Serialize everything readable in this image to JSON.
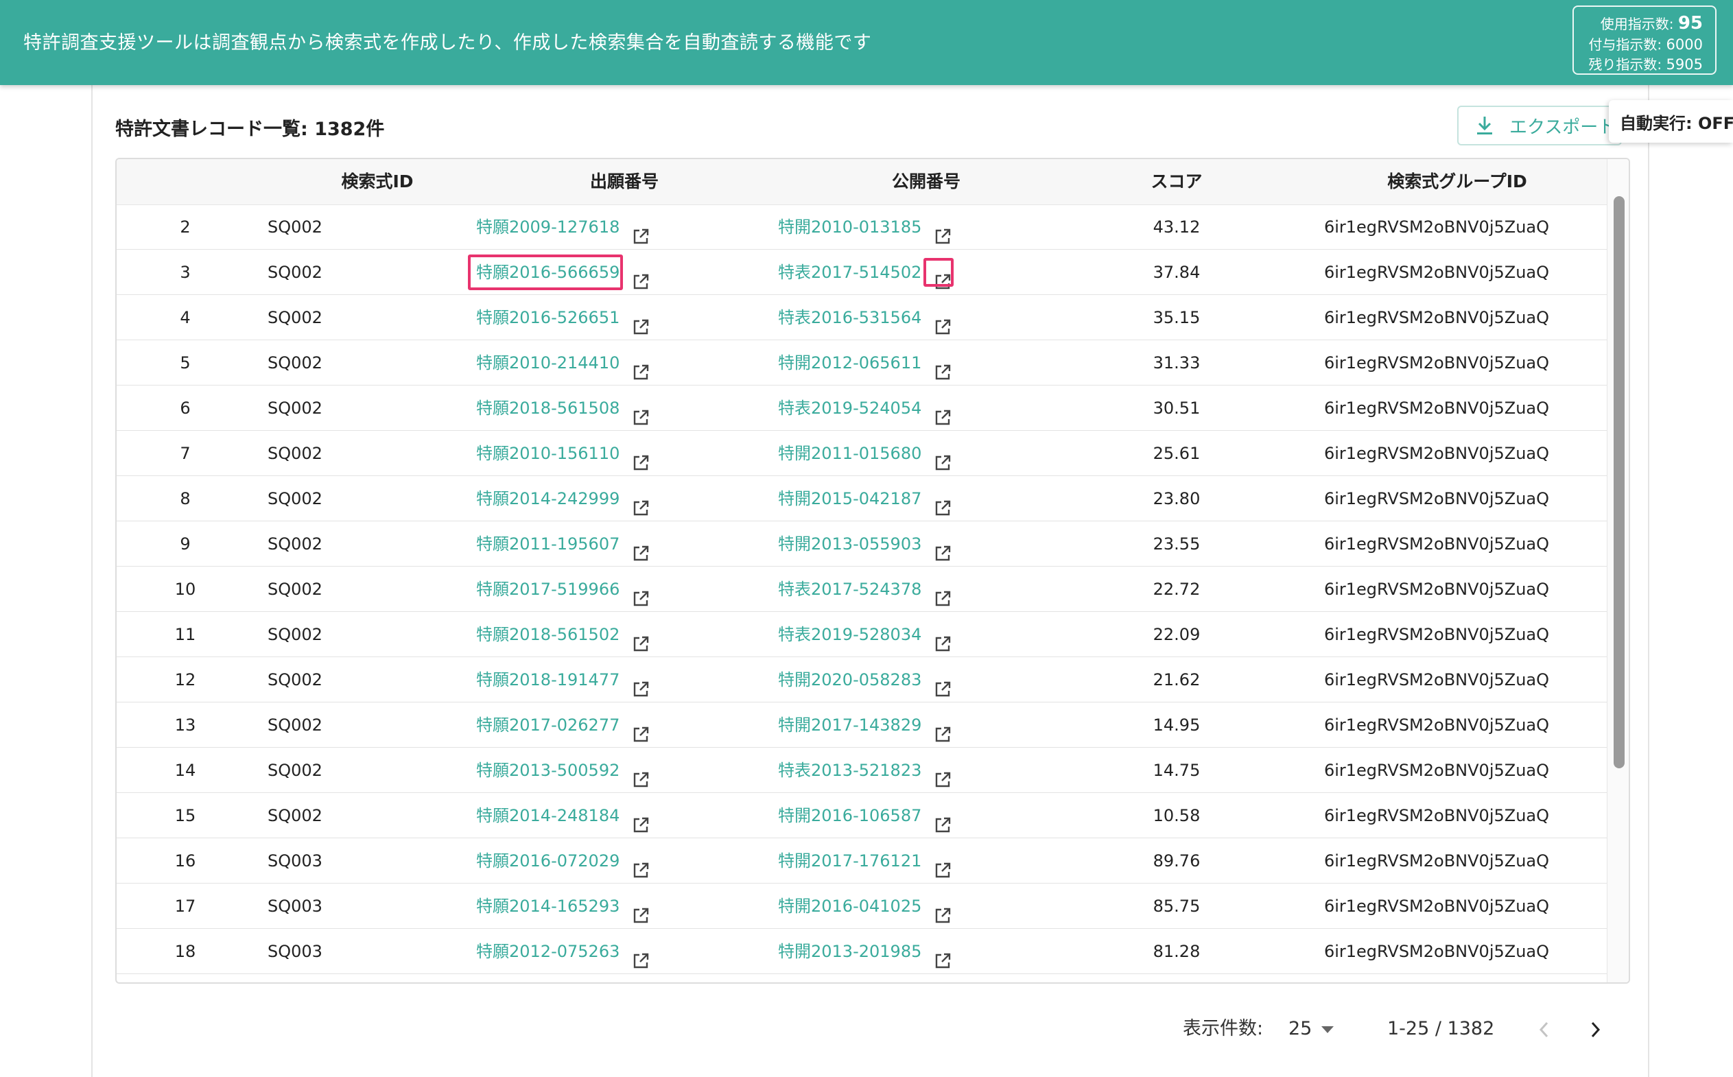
{
  "header": {
    "title": "特許調査支援ツールは調査観点から検索式を作成したり、作成した検索集合を自動査読する機能です",
    "usage": {
      "used_label": "使用指示数:",
      "used_value": "95",
      "granted_label": "付与指示数:",
      "granted_value": "6000",
      "remaining_label": "残り指示数:",
      "remaining_value": "5905"
    }
  },
  "list": {
    "title": "特許文書レコード一覧: 1382件",
    "export_label": "エクスポート",
    "auto_run_label": "自動実行: OFF"
  },
  "table": {
    "columns": [
      "",
      "検索式ID",
      "出願番号",
      "公開番号",
      "スコア",
      "検索式グループID"
    ],
    "rows": [
      {
        "idx": "2",
        "query_id": "SQ002",
        "app_no": "特願2009-127618",
        "pub_no": "特開2010-013185",
        "score": "43.12",
        "group_id": "6ir1egRVSM2oBNV0j5ZuaQ"
      },
      {
        "idx": "3",
        "query_id": "SQ002",
        "app_no": "特願2016-566659",
        "pub_no": "特表2017-514502",
        "score": "37.84",
        "group_id": "6ir1egRVSM2oBNV0j5ZuaQ"
      },
      {
        "idx": "4",
        "query_id": "SQ002",
        "app_no": "特願2016-526651",
        "pub_no": "特表2016-531564",
        "score": "35.15",
        "group_id": "6ir1egRVSM2oBNV0j5ZuaQ"
      },
      {
        "idx": "5",
        "query_id": "SQ002",
        "app_no": "特願2010-214410",
        "pub_no": "特開2012-065611",
        "score": "31.33",
        "group_id": "6ir1egRVSM2oBNV0j5ZuaQ"
      },
      {
        "idx": "6",
        "query_id": "SQ002",
        "app_no": "特願2018-561508",
        "pub_no": "特表2019-524054",
        "score": "30.51",
        "group_id": "6ir1egRVSM2oBNV0j5ZuaQ"
      },
      {
        "idx": "7",
        "query_id": "SQ002",
        "app_no": "特願2010-156110",
        "pub_no": "特開2011-015680",
        "score": "25.61",
        "group_id": "6ir1egRVSM2oBNV0j5ZuaQ"
      },
      {
        "idx": "8",
        "query_id": "SQ002",
        "app_no": "特願2014-242999",
        "pub_no": "特開2015-042187",
        "score": "23.80",
        "group_id": "6ir1egRVSM2oBNV0j5ZuaQ"
      },
      {
        "idx": "9",
        "query_id": "SQ002",
        "app_no": "特願2011-195607",
        "pub_no": "特開2013-055903",
        "score": "23.55",
        "group_id": "6ir1egRVSM2oBNV0j5ZuaQ"
      },
      {
        "idx": "10",
        "query_id": "SQ002",
        "app_no": "特願2017-519966",
        "pub_no": "特表2017-524378",
        "score": "22.72",
        "group_id": "6ir1egRVSM2oBNV0j5ZuaQ"
      },
      {
        "idx": "11",
        "query_id": "SQ002",
        "app_no": "特願2018-561502",
        "pub_no": "特表2019-528034",
        "score": "22.09",
        "group_id": "6ir1egRVSM2oBNV0j5ZuaQ"
      },
      {
        "idx": "12",
        "query_id": "SQ002",
        "app_no": "特願2018-191477",
        "pub_no": "特開2020-058283",
        "score": "21.62",
        "group_id": "6ir1egRVSM2oBNV0j5ZuaQ"
      },
      {
        "idx": "13",
        "query_id": "SQ002",
        "app_no": "特願2017-026277",
        "pub_no": "特開2017-143829",
        "score": "14.95",
        "group_id": "6ir1egRVSM2oBNV0j5ZuaQ"
      },
      {
        "idx": "14",
        "query_id": "SQ002",
        "app_no": "特願2013-500592",
        "pub_no": "特表2013-521823",
        "score": "14.75",
        "group_id": "6ir1egRVSM2oBNV0j5ZuaQ"
      },
      {
        "idx": "15",
        "query_id": "SQ002",
        "app_no": "特願2014-248184",
        "pub_no": "特開2016-106587",
        "score": "10.58",
        "group_id": "6ir1egRVSM2oBNV0j5ZuaQ"
      },
      {
        "idx": "16",
        "query_id": "SQ003",
        "app_no": "特願2016-072029",
        "pub_no": "特開2017-176121",
        "score": "89.76",
        "group_id": "6ir1egRVSM2oBNV0j5ZuaQ"
      },
      {
        "idx": "17",
        "query_id": "SQ003",
        "app_no": "特願2014-165293",
        "pub_no": "特開2016-041025",
        "score": "85.75",
        "group_id": "6ir1egRVSM2oBNV0j5ZuaQ"
      },
      {
        "idx": "18",
        "query_id": "SQ003",
        "app_no": "特願2012-075263",
        "pub_no": "特開2013-201985",
        "score": "81.28",
        "group_id": "6ir1egRVSM2oBNV0j5ZuaQ"
      }
    ]
  },
  "pagination": {
    "per_page_label": "表示件数:",
    "per_page_value": "25",
    "range_text": "1-25 / 1382",
    "prev_icon": "chevron-left-icon",
    "next_icon": "chevron-right-icon"
  },
  "colors": {
    "brand": "#3aab9c",
    "highlight": "#e8336e"
  }
}
